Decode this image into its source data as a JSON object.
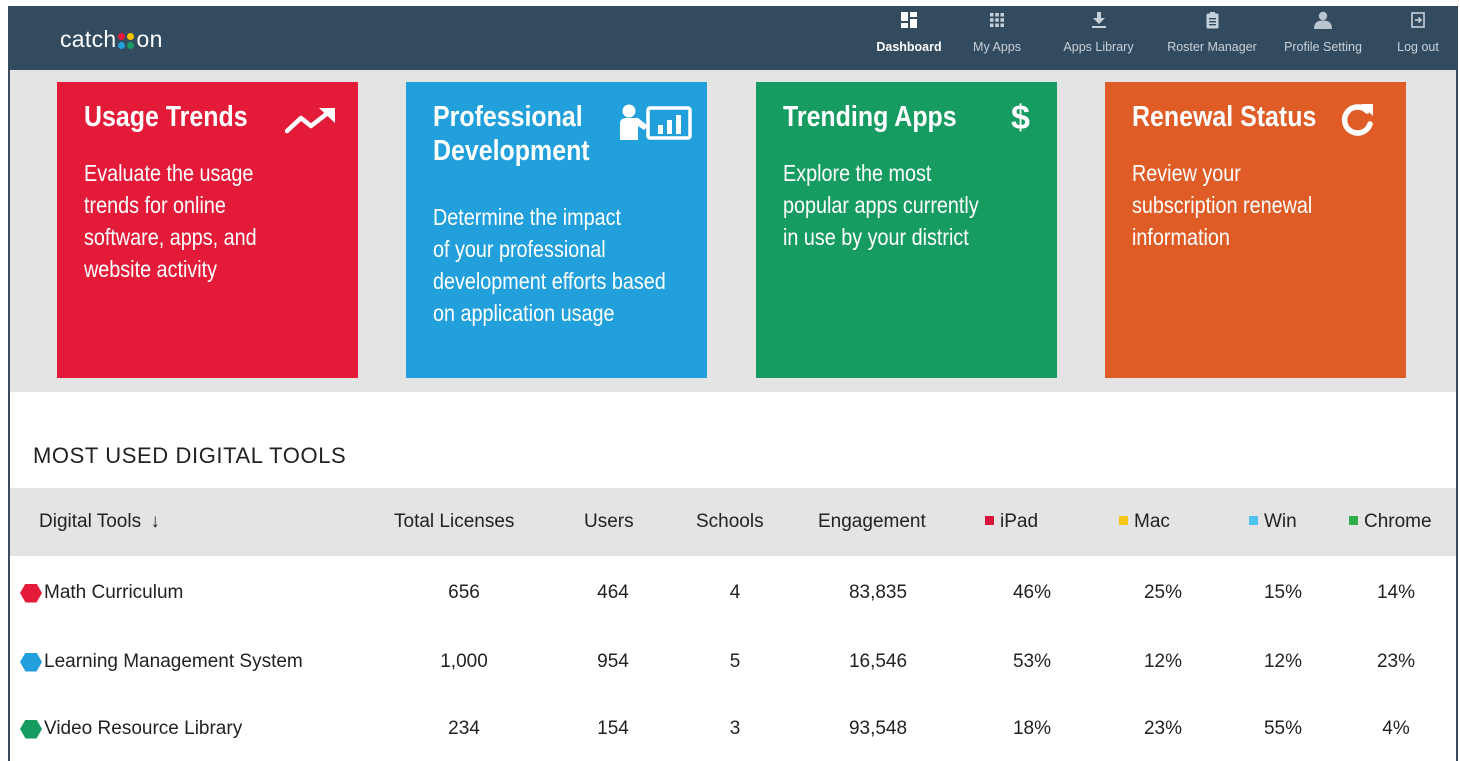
{
  "app": {
    "logo_left": "catch",
    "logo_right": "on",
    "logo_dot_colors": [
      "#e31b39",
      "#f5c400",
      "#21a0dc",
      "#169c60"
    ]
  },
  "nav": {
    "items": [
      {
        "label": "Dashboard",
        "icon": "dashboard-icon",
        "active": true
      },
      {
        "label": "My Apps",
        "icon": "grid-icon",
        "active": false
      },
      {
        "label": "Apps Library",
        "icon": "download-icon",
        "active": false
      },
      {
        "label": "Roster Manager",
        "icon": "clipboard-icon",
        "active": false
      },
      {
        "label": "Profile Setting",
        "icon": "user-icon",
        "active": false
      },
      {
        "label": "Log out",
        "icon": "logout-icon",
        "active": false
      }
    ]
  },
  "cards": [
    {
      "title": "Usage Trends",
      "icon": "trend-up-icon",
      "color": "#e31b39",
      "description": [
        "Evaluate the usage",
        "trends for online",
        "software, apps, and",
        "website activity"
      ]
    },
    {
      "title_lines": [
        "Professional",
        "Development"
      ],
      "icon": "presentation-chart-icon",
      "color": "#21a0dc",
      "description": [
        "Determine the impact",
        "of your professional",
        "development efforts based",
        "on application usage"
      ]
    },
    {
      "title": "Trending Apps",
      "icon": "dollar-icon",
      "color": "#169c60",
      "description": [
        "Explore the most",
        "popular apps currently",
        "in use by your district"
      ]
    },
    {
      "title": "Renewal Status",
      "icon": "refresh-icon",
      "color": "#e05c27",
      "description": [
        "Review  your",
        "subscription renewal",
        "information"
      ]
    }
  ],
  "section": {
    "title": "MOST USED DIGITAL TOOLS"
  },
  "table": {
    "columns": {
      "tool": "Digital Tools",
      "sort_icon": "↓",
      "licenses": "Total Licenses",
      "users": "Users",
      "schools": "Schools",
      "engagement": "Engagement",
      "ipad": "iPad",
      "mac": "Mac",
      "win": "Win",
      "chrome": "Chrome"
    },
    "legend_colors": {
      "ipad": "#d8143a",
      "mac": "#f5c71a",
      "win": "#4fc3f0",
      "chrome": "#2fae4a"
    },
    "rows": [
      {
        "name": "Math Curriculum",
        "color": "#e31b39",
        "licenses": "656",
        "users": "464",
        "schools": "4",
        "engagement": "83,835",
        "ipad": "46%",
        "mac": "25%",
        "win": "15%",
        "chrome": "14%"
      },
      {
        "name": "Learning Management System",
        "color": "#21a0dc",
        "licenses": "1,000",
        "users": "954",
        "schools": "5",
        "engagement": "16,546",
        "ipad": "53%",
        "mac": "12%",
        "win": "12%",
        "chrome": "23%"
      },
      {
        "name": "Video Resource Library",
        "color": "#169c60",
        "licenses": "234",
        "users": "154",
        "schools": "3",
        "engagement": "93,548",
        "ipad": "18%",
        "mac": "23%",
        "win": "55%",
        "chrome": "4%"
      }
    ]
  }
}
